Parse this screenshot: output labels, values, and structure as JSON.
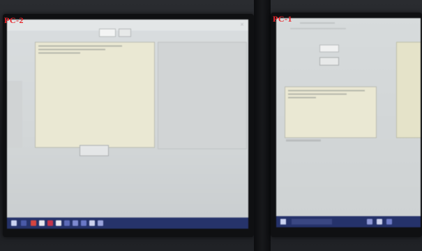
{
  "labels": {
    "left_pc": "PC-2",
    "right_pc": "PC-1"
  },
  "left_screen": {
    "close_glyph": "×",
    "center_button_label": ""
  },
  "right_screen": {
    "title": "",
    "subtitle": ""
  },
  "taskbar_left": {
    "icons": [
      "start-icon",
      "search-icon",
      "taskview-icon",
      "app-icon",
      "app-icon",
      "app-icon",
      "app-icon",
      "app-icon",
      "app-icon",
      "app-icon",
      "app-icon"
    ],
    "tray_text": ""
  },
  "colors": {
    "pc_label": "#e8252b",
    "taskbar": "#26336a",
    "text_area": "#eae8d3"
  }
}
